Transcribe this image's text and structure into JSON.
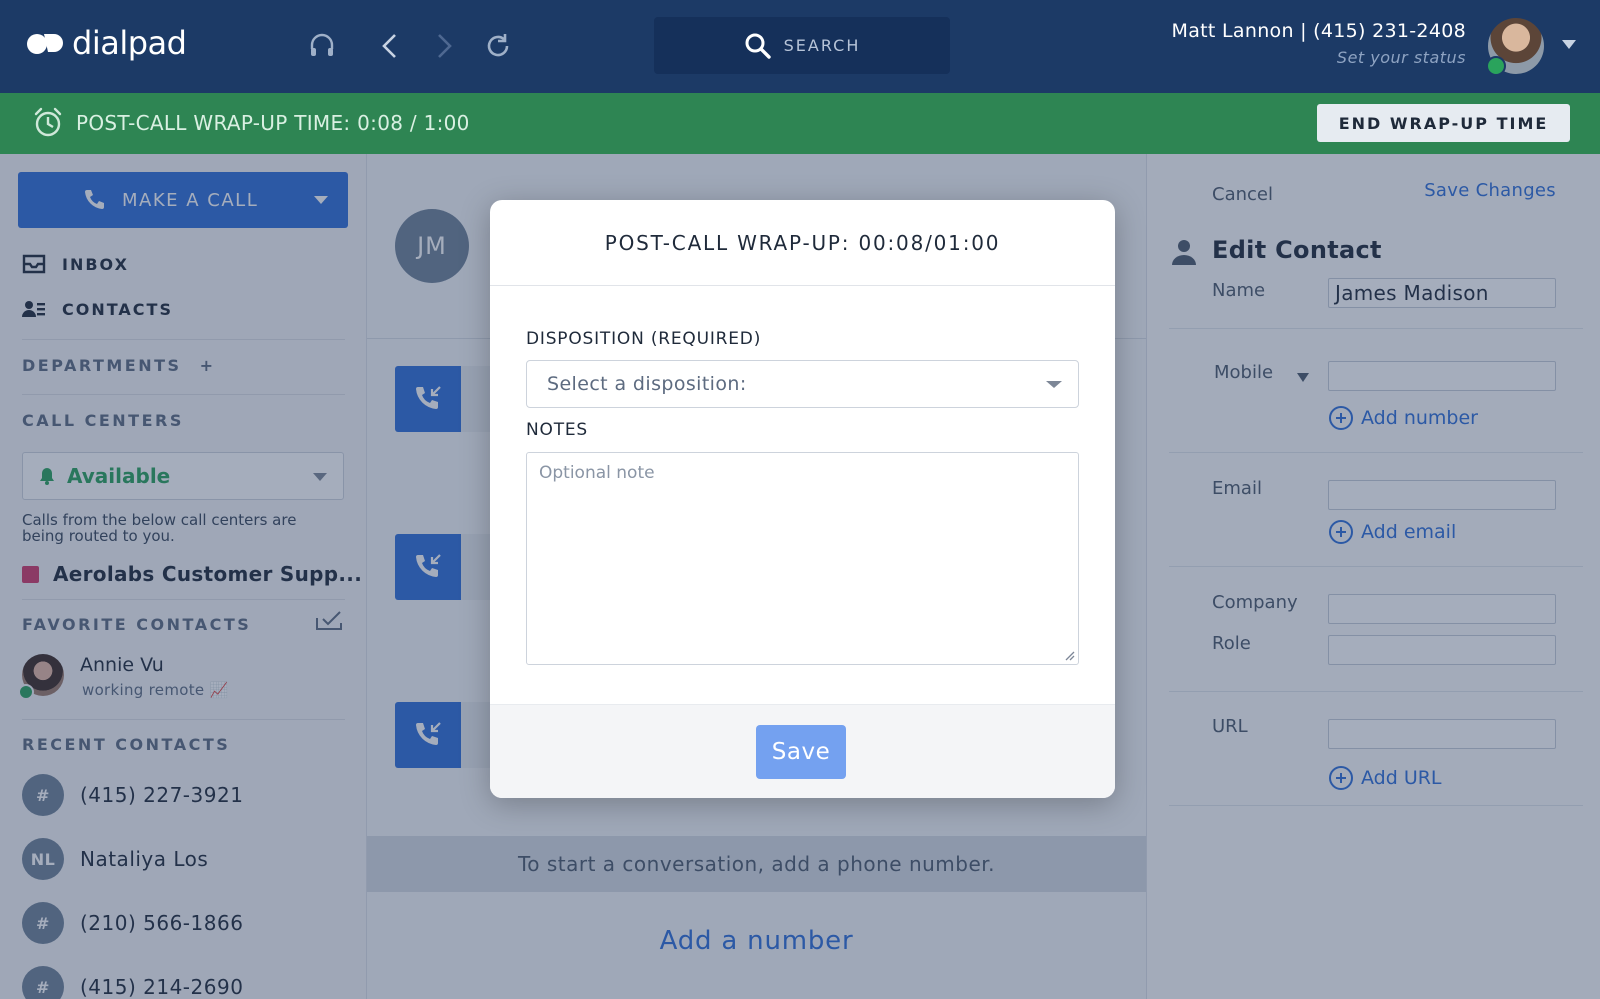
{
  "app": {
    "brand": "dialpad",
    "search_placeholder": "SEARCH",
    "user": {
      "name": "Matt Lannon | (415) 231-2408",
      "status": "Set your status"
    }
  },
  "wrapup_bar": {
    "text": "POST-CALL WRAP-UP TIME: 0:08 / 1:00",
    "end_button": "END WRAP-UP TIME"
  },
  "sidebar": {
    "make_call": "MAKE A CALL",
    "inbox": "INBOX",
    "contacts": "CONTACTS",
    "departments": "DEPARTMENTS",
    "departments_add": "+",
    "call_centers": "CALL CENTERS",
    "availability": "Available",
    "routing_note": "Calls from the below call centers are being routed to you.",
    "call_center_item": "Aerolabs Customer Supp...",
    "favorite_contacts": "FAVORITE CONTACTS",
    "favorite": {
      "name": "Annie Vu",
      "status": "working remote 📈"
    },
    "recent_contacts": "RECENT CONTACTS",
    "recent": [
      {
        "avatar": "#",
        "name": "(415) 227-3921"
      },
      {
        "avatar": "NL",
        "name": "Nataliya Los"
      },
      {
        "avatar": "#",
        "name": "(210) 566-1866"
      },
      {
        "avatar": "#",
        "name": "(415) 214-2690"
      }
    ]
  },
  "main": {
    "contact_initials": "JM",
    "conversation_hint": "To start a conversation, add a phone number.",
    "add_number": "Add a number"
  },
  "modal": {
    "title": "POST-CALL WRAP-UP: 00:08/01:00",
    "disposition_label": "DISPOSITION (REQUIRED)",
    "disposition_placeholder": "Select a disposition:",
    "notes_label": "NOTES",
    "notes_placeholder": "Optional note",
    "save": "Save"
  },
  "edit_contact": {
    "cancel": "Cancel",
    "save": "Save Changes",
    "title": "Edit Contact",
    "name_label": "Name",
    "name_value": "James Madison",
    "mobile_label": "Mobile",
    "add_number": "Add number",
    "email_label": "Email",
    "add_email": "Add email",
    "company_label": "Company",
    "role_label": "Role",
    "url_label": "URL",
    "add_url": "Add URL"
  },
  "colors": {
    "topbar": "#1c3a66",
    "wrapbar": "#2e8553",
    "primary": "#2f6fd8",
    "available": "#2aa35c",
    "call_center_swatch": "#d23a6a"
  },
  "icons": [
    "headset-icon",
    "back-icon",
    "forward-icon",
    "refresh-icon",
    "search-icon",
    "alarm-clock-icon",
    "phone-icon",
    "inbox-icon",
    "contacts-icon",
    "bell-icon",
    "checkmark-icon",
    "incoming-call-icon",
    "person-icon",
    "plus-circle-icon"
  ]
}
